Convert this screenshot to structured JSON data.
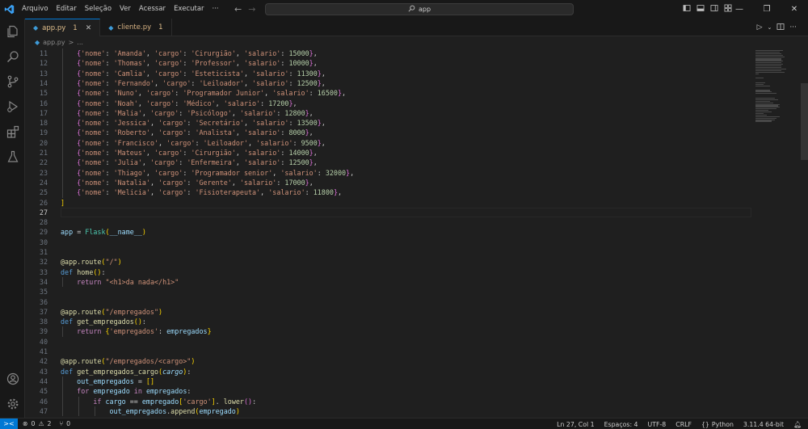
{
  "menu": [
    "Arquivo",
    "Editar",
    "Seleção",
    "Ver",
    "Acessar",
    "Executar",
    "···"
  ],
  "search": {
    "text": "app"
  },
  "tabs": [
    {
      "name": "app.py",
      "count": "1",
      "active": true
    },
    {
      "name": "cliente.py",
      "count": "1",
      "active": false
    }
  ],
  "breadcrumb": {
    "file": "app.py",
    "sep": ">",
    "more": "..."
  },
  "status": {
    "problems_errors": "0",
    "problems_warnings": "2",
    "ports": "0",
    "cursor": "Ln 27, Col 1",
    "spaces": "Espaços: 4",
    "encoding": "UTF-8",
    "eol": "CRLF",
    "language": "Python",
    "interpreter": "3.11.4 64-bit"
  },
  "employees": [
    {
      "line": "11",
      "nome": "Amanda",
      "cargo": "Cirurgião",
      "salario": "15000"
    },
    {
      "line": "12",
      "nome": "Thomas",
      "cargo": "Professor",
      "salario": "10000"
    },
    {
      "line": "13",
      "nome": "Camlia",
      "cargo": "Esteticista",
      "salario": "11300"
    },
    {
      "line": "14",
      "nome": "Fernando",
      "cargo": "Leiloador",
      "salario": "12500"
    },
    {
      "line": "15",
      "nome": "Nuno",
      "cargo": "Programador Junior",
      "salario": "16500"
    },
    {
      "line": "16",
      "nome": "Noah",
      "cargo": "Médico",
      "salario": "17200"
    },
    {
      "line": "17",
      "nome": "Malia",
      "cargo": "Psicólogo",
      "salario": "12800"
    },
    {
      "line": "18",
      "nome": "Jessica",
      "cargo": "Secretário",
      "salario": "13500"
    },
    {
      "line": "19",
      "nome": "Roberto",
      "cargo": "Analista",
      "salario": "8000"
    },
    {
      "line": "20",
      "nome": "Francisco",
      "cargo": "Leiloador",
      "salario": "9500"
    },
    {
      "line": "21",
      "nome": "Mateus",
      "cargo": "Cirurgião",
      "salario": "14000"
    },
    {
      "line": "22",
      "nome": "Julia",
      "cargo": "Enfermeira",
      "salario": "12500"
    },
    {
      "line": "23",
      "nome": "Thiago",
      "cargo": "Programador senior",
      "salario": "32000"
    },
    {
      "line": "24",
      "nome": "Natalia",
      "cargo": "Gerente",
      "salario": "17000"
    },
    {
      "line": "25",
      "nome": "Melicia",
      "cargo": "Fisioterapeuta",
      "salario": "11800"
    }
  ],
  "code_lines": [
    {
      "line": "26",
      "html": "<span class='b1'>]</span>"
    },
    {
      "line": "27",
      "html": "",
      "current": true
    },
    {
      "line": "28",
      "html": ""
    },
    {
      "line": "29",
      "html": "<span class='v'>app</span> <span class='p'>=</span> <span class='c'>Flask</span><span class='b1'>(</span><span class='v'>__name__</span><span class='b1'>)</span>"
    },
    {
      "line": "30",
      "html": ""
    },
    {
      "line": "31",
      "html": ""
    },
    {
      "line": "32",
      "html": "<span class='dec'>@app.route</span><span class='b1'>(</span><span class='s'>\"/\"</span><span class='b1'>)</span>"
    },
    {
      "line": "33",
      "html": "<span class='d'>def</span> <span class='f'>home</span><span class='b1'>()</span><span class='p'>:</span>"
    },
    {
      "line": "34",
      "html": "    <span class='k'>return</span> <span class='s'>\"&lt;h1&gt;da nada&lt;/h1&gt;\"</span>"
    },
    {
      "line": "35",
      "html": ""
    },
    {
      "line": "36",
      "html": ""
    },
    {
      "line": "37",
      "html": "<span class='dec'>@app.route</span><span class='b1'>(</span><span class='s'>\"/empregados\"</span><span class='b1'>)</span>"
    },
    {
      "line": "38",
      "html": "<span class='d'>def</span> <span class='f'>get_empregados</span><span class='b1'>()</span><span class='p'>:</span>"
    },
    {
      "line": "39",
      "html": "    <span class='k'>return</span> <span class='b1'>{</span><span class='s'>'empregados'</span><span class='p'>:</span> <span class='v'>empregados</span><span class='b1'>}</span>"
    },
    {
      "line": "40",
      "html": ""
    },
    {
      "line": "41",
      "html": ""
    },
    {
      "line": "42",
      "html": "<span class='dec'>@app.route</span><span class='b1'>(</span><span class='s'>\"/empregados/&lt;cargo&gt;\"</span><span class='b1'>)</span>"
    },
    {
      "line": "43",
      "html": "<span class='d'>def</span> <span class='f'>get_empregados_cargo</span><span class='b1'>(</span><span class='param'>cargo</span><span class='b1'>)</span><span class='p'>:</span>"
    },
    {
      "line": "44",
      "html": "    <span class='v'>out_empregados</span> <span class='p'>=</span> <span class='b1'>[]</span>"
    },
    {
      "line": "45",
      "html": "    <span class='k'>for</span> <span class='v'>empregado</span> <span class='k'>in</span> <span class='v'>empregados</span><span class='p'>:</span>"
    },
    {
      "line": "46",
      "html": "        <span class='k'>if</span> <span class='v'>cargo</span> <span class='p'>==</span> <span class='v'>empregado</span><span class='b1'>[</span><span class='s'>'cargo'</span><span class='b1'>]</span><span class='p'>.</span> <span class='f'>lower</span><span class='b2'>()</span><span class='p'>:</span>"
    },
    {
      "line": "47",
      "html": "            <span class='v'>out_empregados</span><span class='p'>.</span><span class='f'>append</span><span class='b1'>(</span><span class='v'>empregado</span><span class='b1'>)</span>"
    }
  ]
}
